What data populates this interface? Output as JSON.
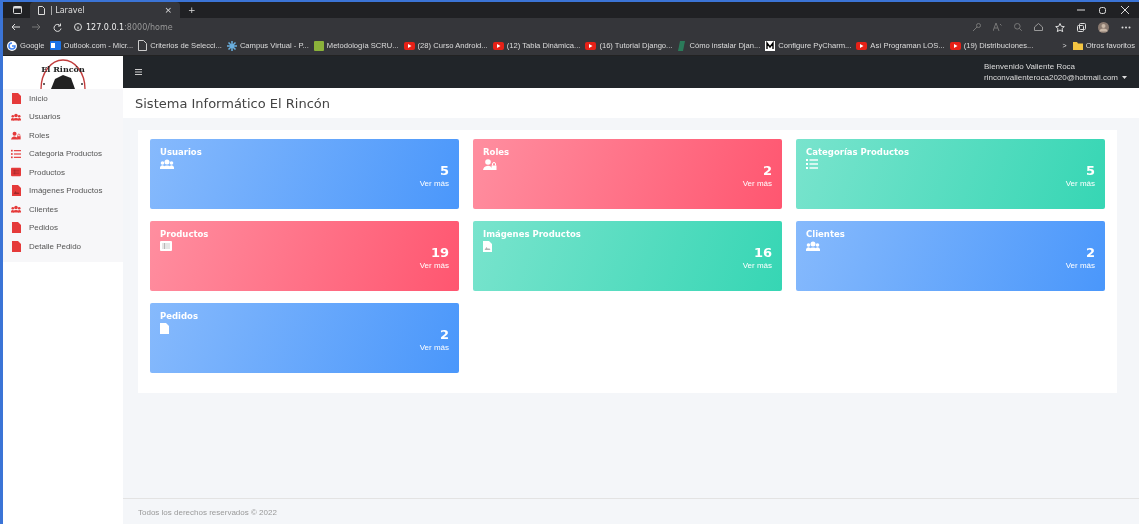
{
  "browser": {
    "tab": {
      "title": "| Laravel",
      "close": "×"
    },
    "new_tab": "+",
    "url_host": "127.0.0.1",
    "url_rest": ":8000/home",
    "bookmarks": [
      {
        "label": "Google",
        "kind": "google"
      },
      {
        "label": "Outlook.com - Micr...",
        "kind": "mail"
      },
      {
        "label": "Criterios de Selecci...",
        "kind": "page"
      },
      {
        "label": "Campus Virtual - P...",
        "kind": "campus"
      },
      {
        "label": "Metodología SCRU...",
        "kind": "green"
      },
      {
        "label": "(28) Curso Android...",
        "kind": "video"
      },
      {
        "label": "(12) Tabla Dinámica...",
        "kind": "video"
      },
      {
        "label": "(16) Tutorial Django...",
        "kind": "video"
      },
      {
        "label": "Cómo instalar Djan...",
        "kind": "dj"
      },
      {
        "label": "Configure PyCharm...",
        "kind": "m"
      },
      {
        "label": "Así Programan LOS...",
        "kind": "video"
      },
      {
        "label": "(19) Distribuciones...",
        "kind": "video"
      }
    ],
    "more": ">",
    "other_favorites": "Otros favoritos"
  },
  "app": {
    "logo_text": "El Rincón",
    "user": {
      "greeting": "Bienvenido Valiente Roca",
      "email": "rinconvalienteroca2020@hotmail.com"
    },
    "sidebar": [
      {
        "label": "Inicio",
        "kind": "file"
      },
      {
        "label": "Usuarios",
        "kind": "users"
      },
      {
        "label": "Roles",
        "kind": "user-lock"
      },
      {
        "label": "Categoria Productos",
        "kind": "list"
      },
      {
        "label": "Productos",
        "kind": "table"
      },
      {
        "label": "Imágenes Productos",
        "kind": "image"
      },
      {
        "label": "Clientes",
        "kind": "users"
      },
      {
        "label": "Pedidos",
        "kind": "file"
      },
      {
        "label": "Detalle Pedido",
        "kind": "file"
      }
    ],
    "page_title": "Sistema Informático El Rincón",
    "cards": [
      {
        "title": "Usuarios",
        "kind": "users",
        "count": "5",
        "link": "Ver más",
        "color": "#4a97fb"
      },
      {
        "title": "Roles",
        "kind": "user-lock",
        "count": "2",
        "link": "Ver más",
        "color": "#ff5670"
      },
      {
        "title": "Categorías Productos",
        "kind": "list",
        "count": "5",
        "link": "Ver más",
        "color": "#36d6b4"
      },
      {
        "title": "Productos",
        "kind": "table",
        "count": "19",
        "link": "Ver más",
        "color": "#ff5670"
      },
      {
        "title": "Imágenes Productos",
        "kind": "image",
        "count": "16",
        "link": "Ver más",
        "color": "#36d6b4"
      },
      {
        "title": "Clientes",
        "kind": "users",
        "count": "2",
        "link": "Ver más",
        "color": "#4a97fb"
      },
      {
        "title": "Pedidos",
        "kind": "file",
        "count": "2",
        "link": "Ver más",
        "color": "#4a97fb"
      }
    ],
    "footer": "Todos los derechos reservados © 2022"
  }
}
